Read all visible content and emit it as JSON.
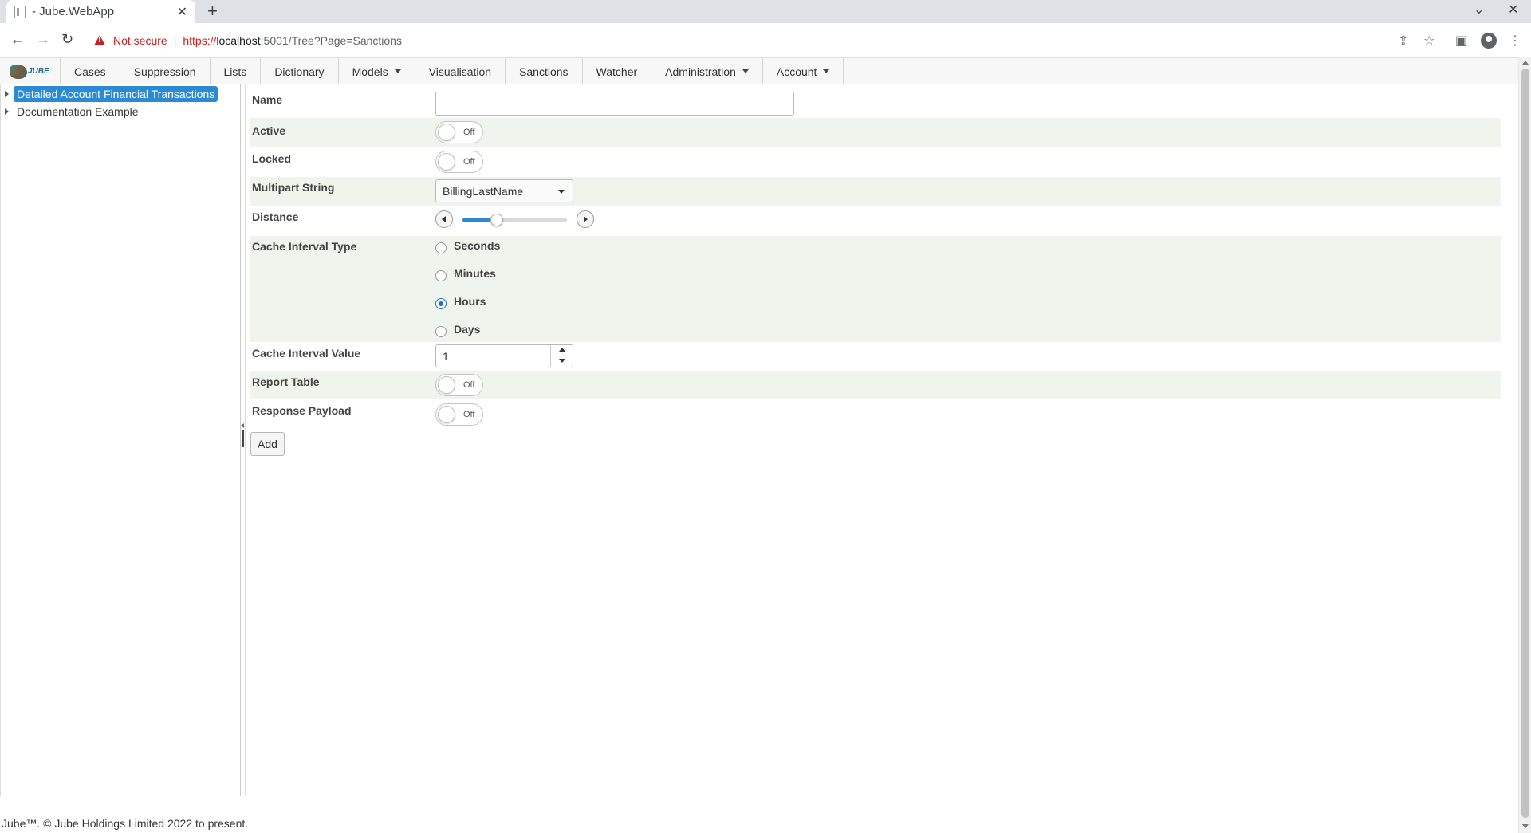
{
  "browser": {
    "tab_title": "- Jube.WebApp",
    "new_tab_label": "+",
    "security_label": "Not secure",
    "url_scheme": "https://",
    "url_host": "localhost",
    "url_path": ":5001/Tree?Page=Sanctions"
  },
  "app": {
    "logo_text": "JUBE",
    "menu": [
      {
        "label": "Cases",
        "dropdown": false
      },
      {
        "label": "Suppression",
        "dropdown": false
      },
      {
        "label": "Lists",
        "dropdown": false
      },
      {
        "label": "Dictionary",
        "dropdown": false
      },
      {
        "label": "Models",
        "dropdown": true
      },
      {
        "label": "Visualisation",
        "dropdown": false
      },
      {
        "label": "Sanctions",
        "dropdown": false
      },
      {
        "label": "Watcher",
        "dropdown": false
      },
      {
        "label": "Administration",
        "dropdown": true
      },
      {
        "label": "Account",
        "dropdown": true
      }
    ]
  },
  "tree": {
    "nodes": [
      {
        "label": "Detailed Account Financial Transactions",
        "selected": true
      },
      {
        "label": "Documentation Example",
        "selected": false
      }
    ]
  },
  "form": {
    "name": {
      "label": "Name",
      "value": ""
    },
    "active": {
      "label": "Active",
      "state": "Off"
    },
    "locked": {
      "label": "Locked",
      "state": "Off"
    },
    "multipart_string": {
      "label": "Multipart String",
      "value": "BillingLastName"
    },
    "distance": {
      "label": "Distance",
      "fraction": 0.33
    },
    "cache_interval_type": {
      "label": "Cache Interval Type",
      "options": [
        "Seconds",
        "Minutes",
        "Hours",
        "Days"
      ],
      "selected": "Hours"
    },
    "cache_interval_value": {
      "label": "Cache Interval Value",
      "value": "1"
    },
    "report_table": {
      "label": "Report Table",
      "state": "Off"
    },
    "response_payload": {
      "label": "Response Payload",
      "state": "Off"
    },
    "add_label": "Add"
  },
  "footer": {
    "text": "Jube™. © Jube Holdings Limited 2022 to present."
  },
  "colors": {
    "accent": "#2a8ad4",
    "row_alt": "#eff5ec",
    "warning": "#c5221f"
  }
}
